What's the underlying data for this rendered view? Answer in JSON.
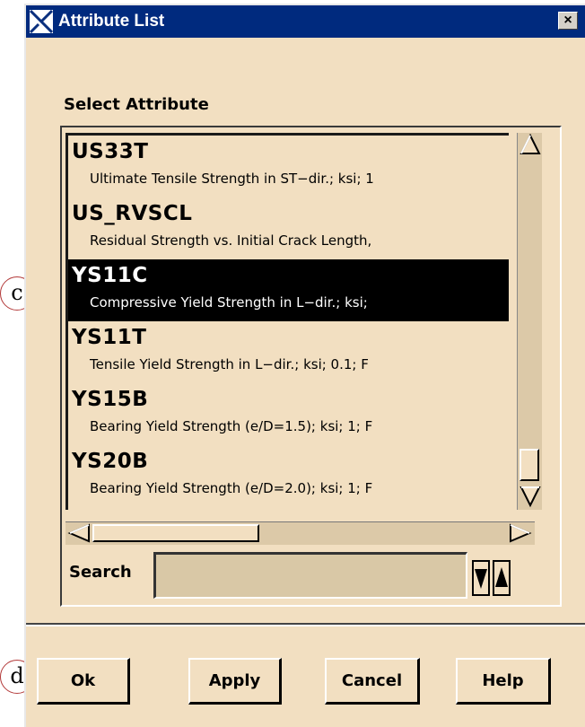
{
  "window": {
    "title": "Attribute List",
    "close_glyph": "×"
  },
  "list_section": {
    "label": "Select Attribute",
    "items": [
      {
        "code": "US33T",
        "desc": "Ultimate Tensile Strength in ST−dir.;  ksi;  1",
        "selected": false
      },
      {
        "code": "US_RVSCL",
        "desc": "Residual Strength vs. Initial Crack Length,",
        "selected": false
      },
      {
        "code": "YS11C",
        "desc": "Compressive Yield Strength in L−dir.;  ksi;",
        "selected": true
      },
      {
        "code": "YS11T",
        "desc": "Tensile Yield Strength in L−dir.;  ksi;  0.1;  F",
        "selected": false
      },
      {
        "code": "YS15B",
        "desc": "Bearing Yield Strength (e/D=1.5);  ksi;  1;  F",
        "selected": false
      },
      {
        "code": "YS20B",
        "desc": "Bearing Yield Strength (e/D=2.0);  ksi;  1;  F",
        "selected": false
      }
    ]
  },
  "search": {
    "label": "Search",
    "value": ""
  },
  "buttons": {
    "ok": "Ok",
    "apply": "Apply",
    "cancel": "Cancel",
    "help": "Help"
  },
  "callouts": {
    "c": "c",
    "d": "d"
  },
  "icons": {
    "title_logo": "window-logo-icon",
    "scroll_up": "scroll-up-arrow-icon",
    "scroll_down": "scroll-down-arrow-icon",
    "scroll_left": "scroll-left-arrow-icon",
    "scroll_right": "scroll-right-arrow-icon",
    "spin_down": "search-down-arrow-icon",
    "spin_up": "search-up-arrow-icon"
  },
  "colors": {
    "titlebar": "#002a7e",
    "panel": "#f2dfc1",
    "selection": "#000000",
    "callout_ring": "#b33a3a"
  }
}
